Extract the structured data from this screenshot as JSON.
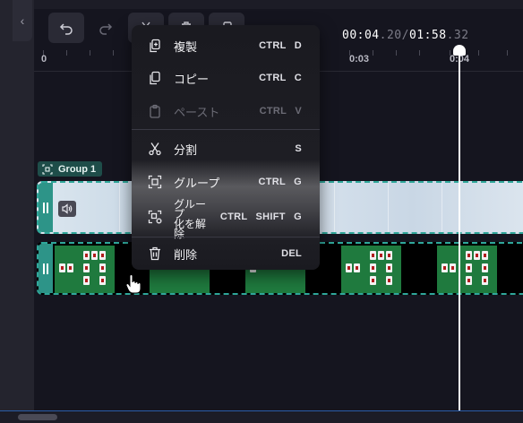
{
  "toolbar": {
    "buttons": [
      {
        "name": "undo",
        "icon": "undo-icon",
        "enabled": true
      },
      {
        "name": "redo",
        "icon": "redo-icon",
        "enabled": false
      },
      {
        "name": "split",
        "icon": "scissors-icon",
        "enabled": true
      },
      {
        "name": "delete",
        "icon": "trash-icon",
        "enabled": true
      },
      {
        "name": "duplicate",
        "icon": "duplicate-icon",
        "enabled": true
      }
    ],
    "time": {
      "current_main": "00:04",
      "current_frac": ".20",
      "separator": "/",
      "total_main": "01:58",
      "total_frac": ".32"
    }
  },
  "ruler": {
    "labels": [
      "0",
      "0:03",
      "0:04"
    ]
  },
  "group_badge": {
    "label": "Group 1",
    "icon": "group-icon"
  },
  "context_menu": {
    "items": [
      {
        "id": "duplicate",
        "label": "複製",
        "shortcut": "CTRL  D",
        "icon": "duplicate-icon",
        "enabled": true
      },
      {
        "id": "copy",
        "label": "コピー",
        "shortcut": "CTRL  C",
        "icon": "copy-icon",
        "enabled": true
      },
      {
        "id": "paste",
        "label": "ペースト",
        "shortcut": "CTRL  V",
        "icon": "paste-icon",
        "enabled": false
      },
      {
        "id": "split",
        "label": "分割",
        "shortcut": "S",
        "icon": "scissors-icon",
        "enabled": true
      },
      {
        "id": "group",
        "label": "グループ",
        "shortcut": "CTRL  G",
        "icon": "group-icon",
        "enabled": true
      },
      {
        "id": "ungroup",
        "label": "グループ化を解除",
        "label_lines": [
          "グループ",
          "化を解",
          "除"
        ],
        "shortcut": "CTRL  SHIFT  G",
        "icon": "ungroup-icon",
        "enabled": true
      },
      {
        "id": "delete",
        "label": "削除",
        "shortcut": "DEL",
        "icon": "trash-icon",
        "enabled": true
      }
    ]
  },
  "colors": {
    "accent": "#2fa79a",
    "handle": "#2d9488",
    "group_badge_bg": "#1e4d49",
    "thumbnail_green": "#1f7a3e",
    "background": "#15151f"
  },
  "cursor": {
    "icon": "hand-pointer-icon"
  }
}
